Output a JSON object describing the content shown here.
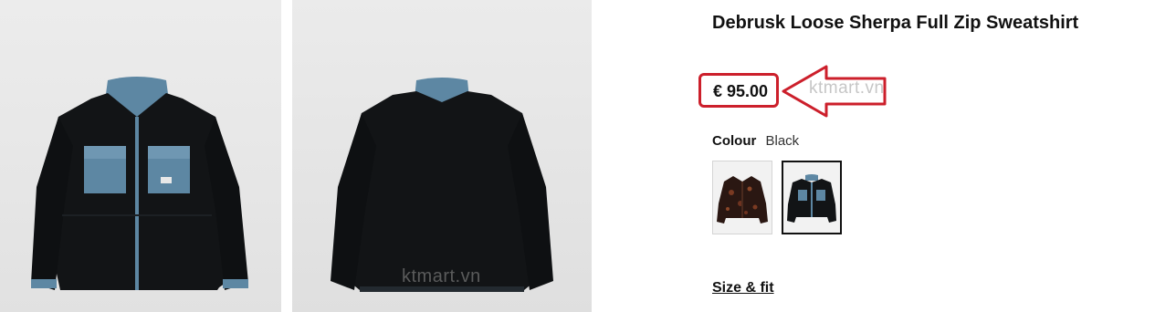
{
  "gallery": {
    "images": [
      {
        "view": "front",
        "icon": "jacket-front-photo"
      },
      {
        "view": "back",
        "icon": "jacket-back-photo"
      }
    ],
    "watermark": "ktmart.vn"
  },
  "product": {
    "title": "Debrusk Loose Sherpa Full Zip Sweatshirt",
    "price": "€ 95.00",
    "price_watermark": "ktmart.vn",
    "colour_label": "Colour",
    "colour_value": "Black",
    "swatches": [
      {
        "name": "brown-pattern",
        "selected": false
      },
      {
        "name": "black",
        "selected": true
      }
    ],
    "size_fit_label": "Size & fit"
  },
  "colors": {
    "annotation_red": "#cc1f2b",
    "jacket_black": "#121416",
    "trim_blue": "#5d87a3"
  }
}
